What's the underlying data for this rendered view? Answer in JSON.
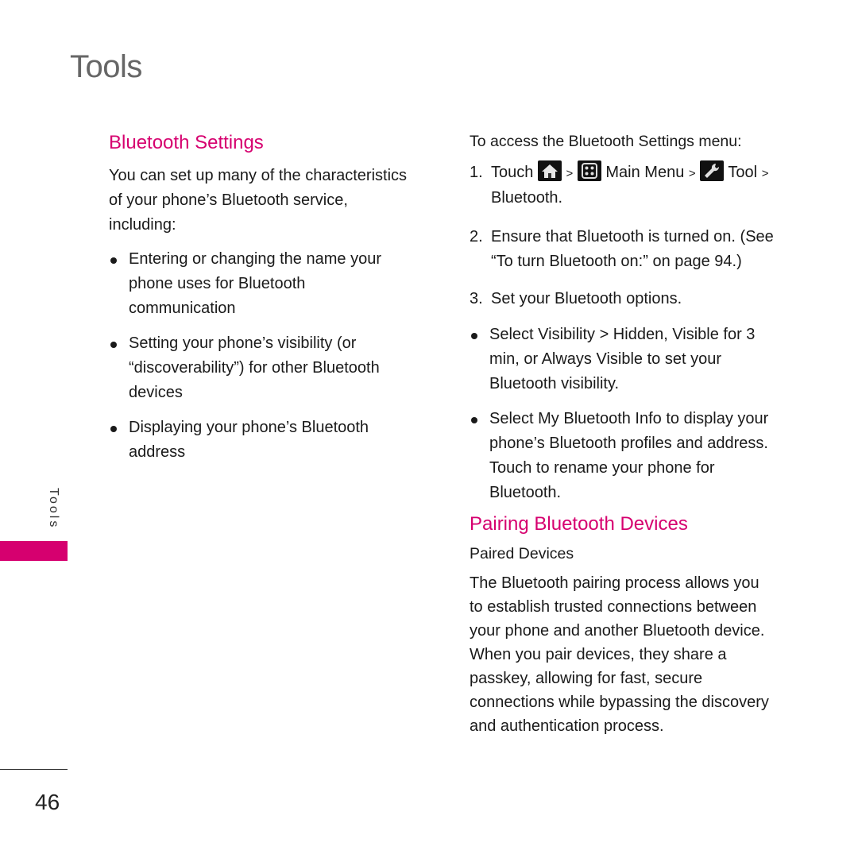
{
  "header": {
    "section_title": "Tools"
  },
  "side_tab": {
    "label": "Tools",
    "accent_color": "#d6006f"
  },
  "left_column": {
    "heading": "Bluetooth Settings",
    "intro": [
      "You can set up many of the characteristics",
      "of your phone’s Bluetooth service,",
      "including:"
    ],
    "bullets": [
      {
        "lines": [
          "Entering or changing the name your",
          "phone uses for Bluetooth",
          "communication"
        ]
      },
      {
        "lines": [
          "Setting your phone’s visibility (or",
          "“discoverability”) for other Bluetooth",
          "devices"
        ]
      },
      {
        "lines": [
          "Displaying your phone’s Bluetooth",
          "address"
        ]
      }
    ]
  },
  "right_column": {
    "access_heading": "To access the Bluetooth Settings menu:",
    "step1": {
      "num": "1.",
      "touch": "Touch",
      "sep": ">",
      "home_icon": "home-icon",
      "main_menu": "Main Menu",
      "main_menu_icon": "grid-menu-icon",
      "tool": "Tool",
      "tool_icon": "wrench-icon",
      "bluetooth": "Bluetooth."
    },
    "step2": {
      "num": "2.",
      "lines": [
        "Ensure that Bluetooth is turned on. (See",
        "“To turn Bluetooth on:” on page 94.)"
      ]
    },
    "step3": {
      "num": "3.",
      "lines": [
        "Set your Bluetooth options."
      ]
    },
    "bullets": [
      {
        "lines": [
          "Select Visibility > Hidden, Visible for 3",
          "min, or Always Visible to set your",
          "Bluetooth visibility."
        ]
      },
      {
        "lines": [
          "Select My Bluetooth Info to display your",
          "phone’s Bluetooth profiles and address.",
          "Touch to rename your phone for",
          "Bluetooth."
        ]
      }
    ],
    "pairing_heading": "Pairing Bluetooth Devices",
    "paired_subheading": "Paired Devices",
    "paired_body": [
      "The Bluetooth pairing process allows you",
      "to establish trusted connections between",
      "your phone and another Bluetooth device.",
      "When you pair devices, they share a",
      "passkey, allowing for fast, secure",
      "connections while bypassing the discovery",
      "and authentication process."
    ]
  },
  "footer": {
    "page_number": "46"
  }
}
